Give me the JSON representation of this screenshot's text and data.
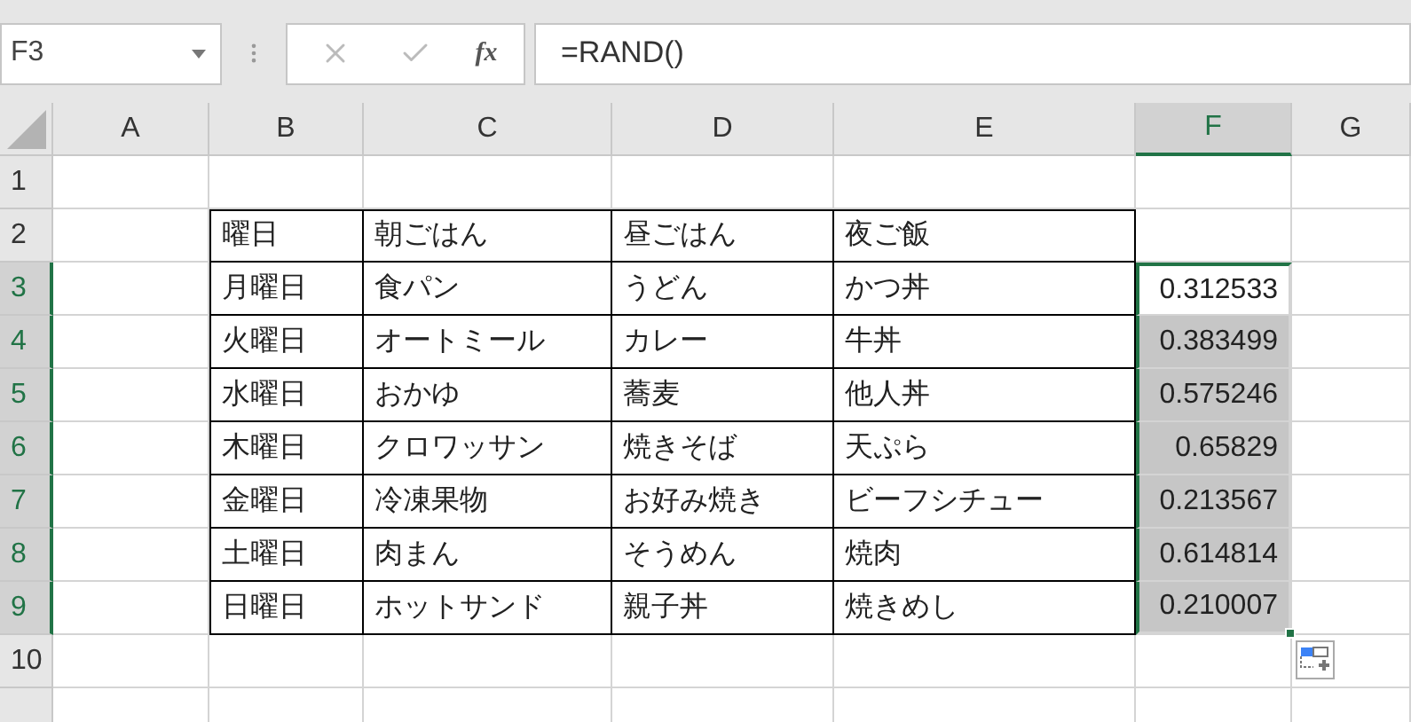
{
  "name_box": {
    "value": "F3"
  },
  "function_button": {
    "label": "fx"
  },
  "formula_bar": {
    "value": "=RAND()"
  },
  "columns": [
    {
      "label": "A",
      "selected": false
    },
    {
      "label": "B",
      "selected": false
    },
    {
      "label": "C",
      "selected": false
    },
    {
      "label": "D",
      "selected": false
    },
    {
      "label": "E",
      "selected": false
    },
    {
      "label": "F",
      "selected": true
    },
    {
      "label": "G",
      "selected": false
    }
  ],
  "rows": [
    {
      "label": "1",
      "selected": false,
      "cells": [
        null,
        null,
        null,
        null,
        null,
        null,
        null
      ]
    },
    {
      "label": "2",
      "selected": false,
      "cells": [
        null,
        {
          "text": "曜日",
          "kind": "text",
          "bordered": true
        },
        {
          "text": "朝ごはん",
          "kind": "text",
          "bordered": true
        },
        {
          "text": "昼ごはん",
          "kind": "text",
          "bordered": true
        },
        {
          "text": "夜ご飯",
          "kind": "text",
          "bordered": true
        },
        null,
        null
      ]
    },
    {
      "label": "3",
      "selected": true,
      "cells": [
        null,
        {
          "text": "月曜日",
          "kind": "text",
          "bordered": true
        },
        {
          "text": "食パン",
          "kind": "text",
          "bordered": true
        },
        {
          "text": "うどん",
          "kind": "text",
          "bordered": true
        },
        {
          "text": "かつ丼",
          "kind": "text",
          "bordered": true
        },
        {
          "text": "0.312533",
          "kind": "number",
          "selected": true,
          "active": true
        },
        null
      ]
    },
    {
      "label": "4",
      "selected": true,
      "cells": [
        null,
        {
          "text": "火曜日",
          "kind": "text",
          "bordered": true
        },
        {
          "text": "オートミール",
          "kind": "text",
          "bordered": true
        },
        {
          "text": "カレー",
          "kind": "text",
          "bordered": true
        },
        {
          "text": "牛丼",
          "kind": "text",
          "bordered": true
        },
        {
          "text": "0.383499",
          "kind": "number",
          "selected": true,
          "active": false
        },
        null
      ]
    },
    {
      "label": "5",
      "selected": true,
      "cells": [
        null,
        {
          "text": "水曜日",
          "kind": "text",
          "bordered": true
        },
        {
          "text": "おかゆ",
          "kind": "text",
          "bordered": true
        },
        {
          "text": "蕎麦",
          "kind": "text",
          "bordered": true
        },
        {
          "text": "他人丼",
          "kind": "text",
          "bordered": true
        },
        {
          "text": "0.575246",
          "kind": "number",
          "selected": true,
          "active": false
        },
        null
      ]
    },
    {
      "label": "6",
      "selected": true,
      "cells": [
        null,
        {
          "text": "木曜日",
          "kind": "text",
          "bordered": true
        },
        {
          "text": "クロワッサン",
          "kind": "text",
          "bordered": true
        },
        {
          "text": "焼きそば",
          "kind": "text",
          "bordered": true
        },
        {
          "text": "天ぷら",
          "kind": "text",
          "bordered": true
        },
        {
          "text": "0.65829",
          "kind": "number",
          "selected": true,
          "active": false
        },
        null
      ]
    },
    {
      "label": "7",
      "selected": true,
      "cells": [
        null,
        {
          "text": "金曜日",
          "kind": "text",
          "bordered": true
        },
        {
          "text": "冷凍果物",
          "kind": "text",
          "bordered": true
        },
        {
          "text": "お好み焼き",
          "kind": "text",
          "bordered": true
        },
        {
          "text": "ビーフシチュー",
          "kind": "text",
          "bordered": true
        },
        {
          "text": "0.213567",
          "kind": "number",
          "selected": true,
          "active": false
        },
        null
      ]
    },
    {
      "label": "8",
      "selected": true,
      "cells": [
        null,
        {
          "text": "土曜日",
          "kind": "text",
          "bordered": true
        },
        {
          "text": "肉まん",
          "kind": "text",
          "bordered": true
        },
        {
          "text": "そうめん",
          "kind": "text",
          "bordered": true
        },
        {
          "text": "焼肉",
          "kind": "text",
          "bordered": true
        },
        {
          "text": "0.614814",
          "kind": "number",
          "selected": true,
          "active": false
        },
        null
      ]
    },
    {
      "label": "9",
      "selected": true,
      "cells": [
        null,
        {
          "text": "日曜日",
          "kind": "text",
          "bordered": true
        },
        {
          "text": "ホットサンド",
          "kind": "text",
          "bordered": true
        },
        {
          "text": "親子丼",
          "kind": "text",
          "bordered": true
        },
        {
          "text": "焼きめし",
          "kind": "text",
          "bordered": true
        },
        {
          "text": "0.210007",
          "kind": "number",
          "selected": true,
          "active": false
        },
        null
      ]
    },
    {
      "label": "10",
      "selected": false,
      "cells": [
        null,
        null,
        null,
        null,
        null,
        null,
        null
      ]
    }
  ]
}
